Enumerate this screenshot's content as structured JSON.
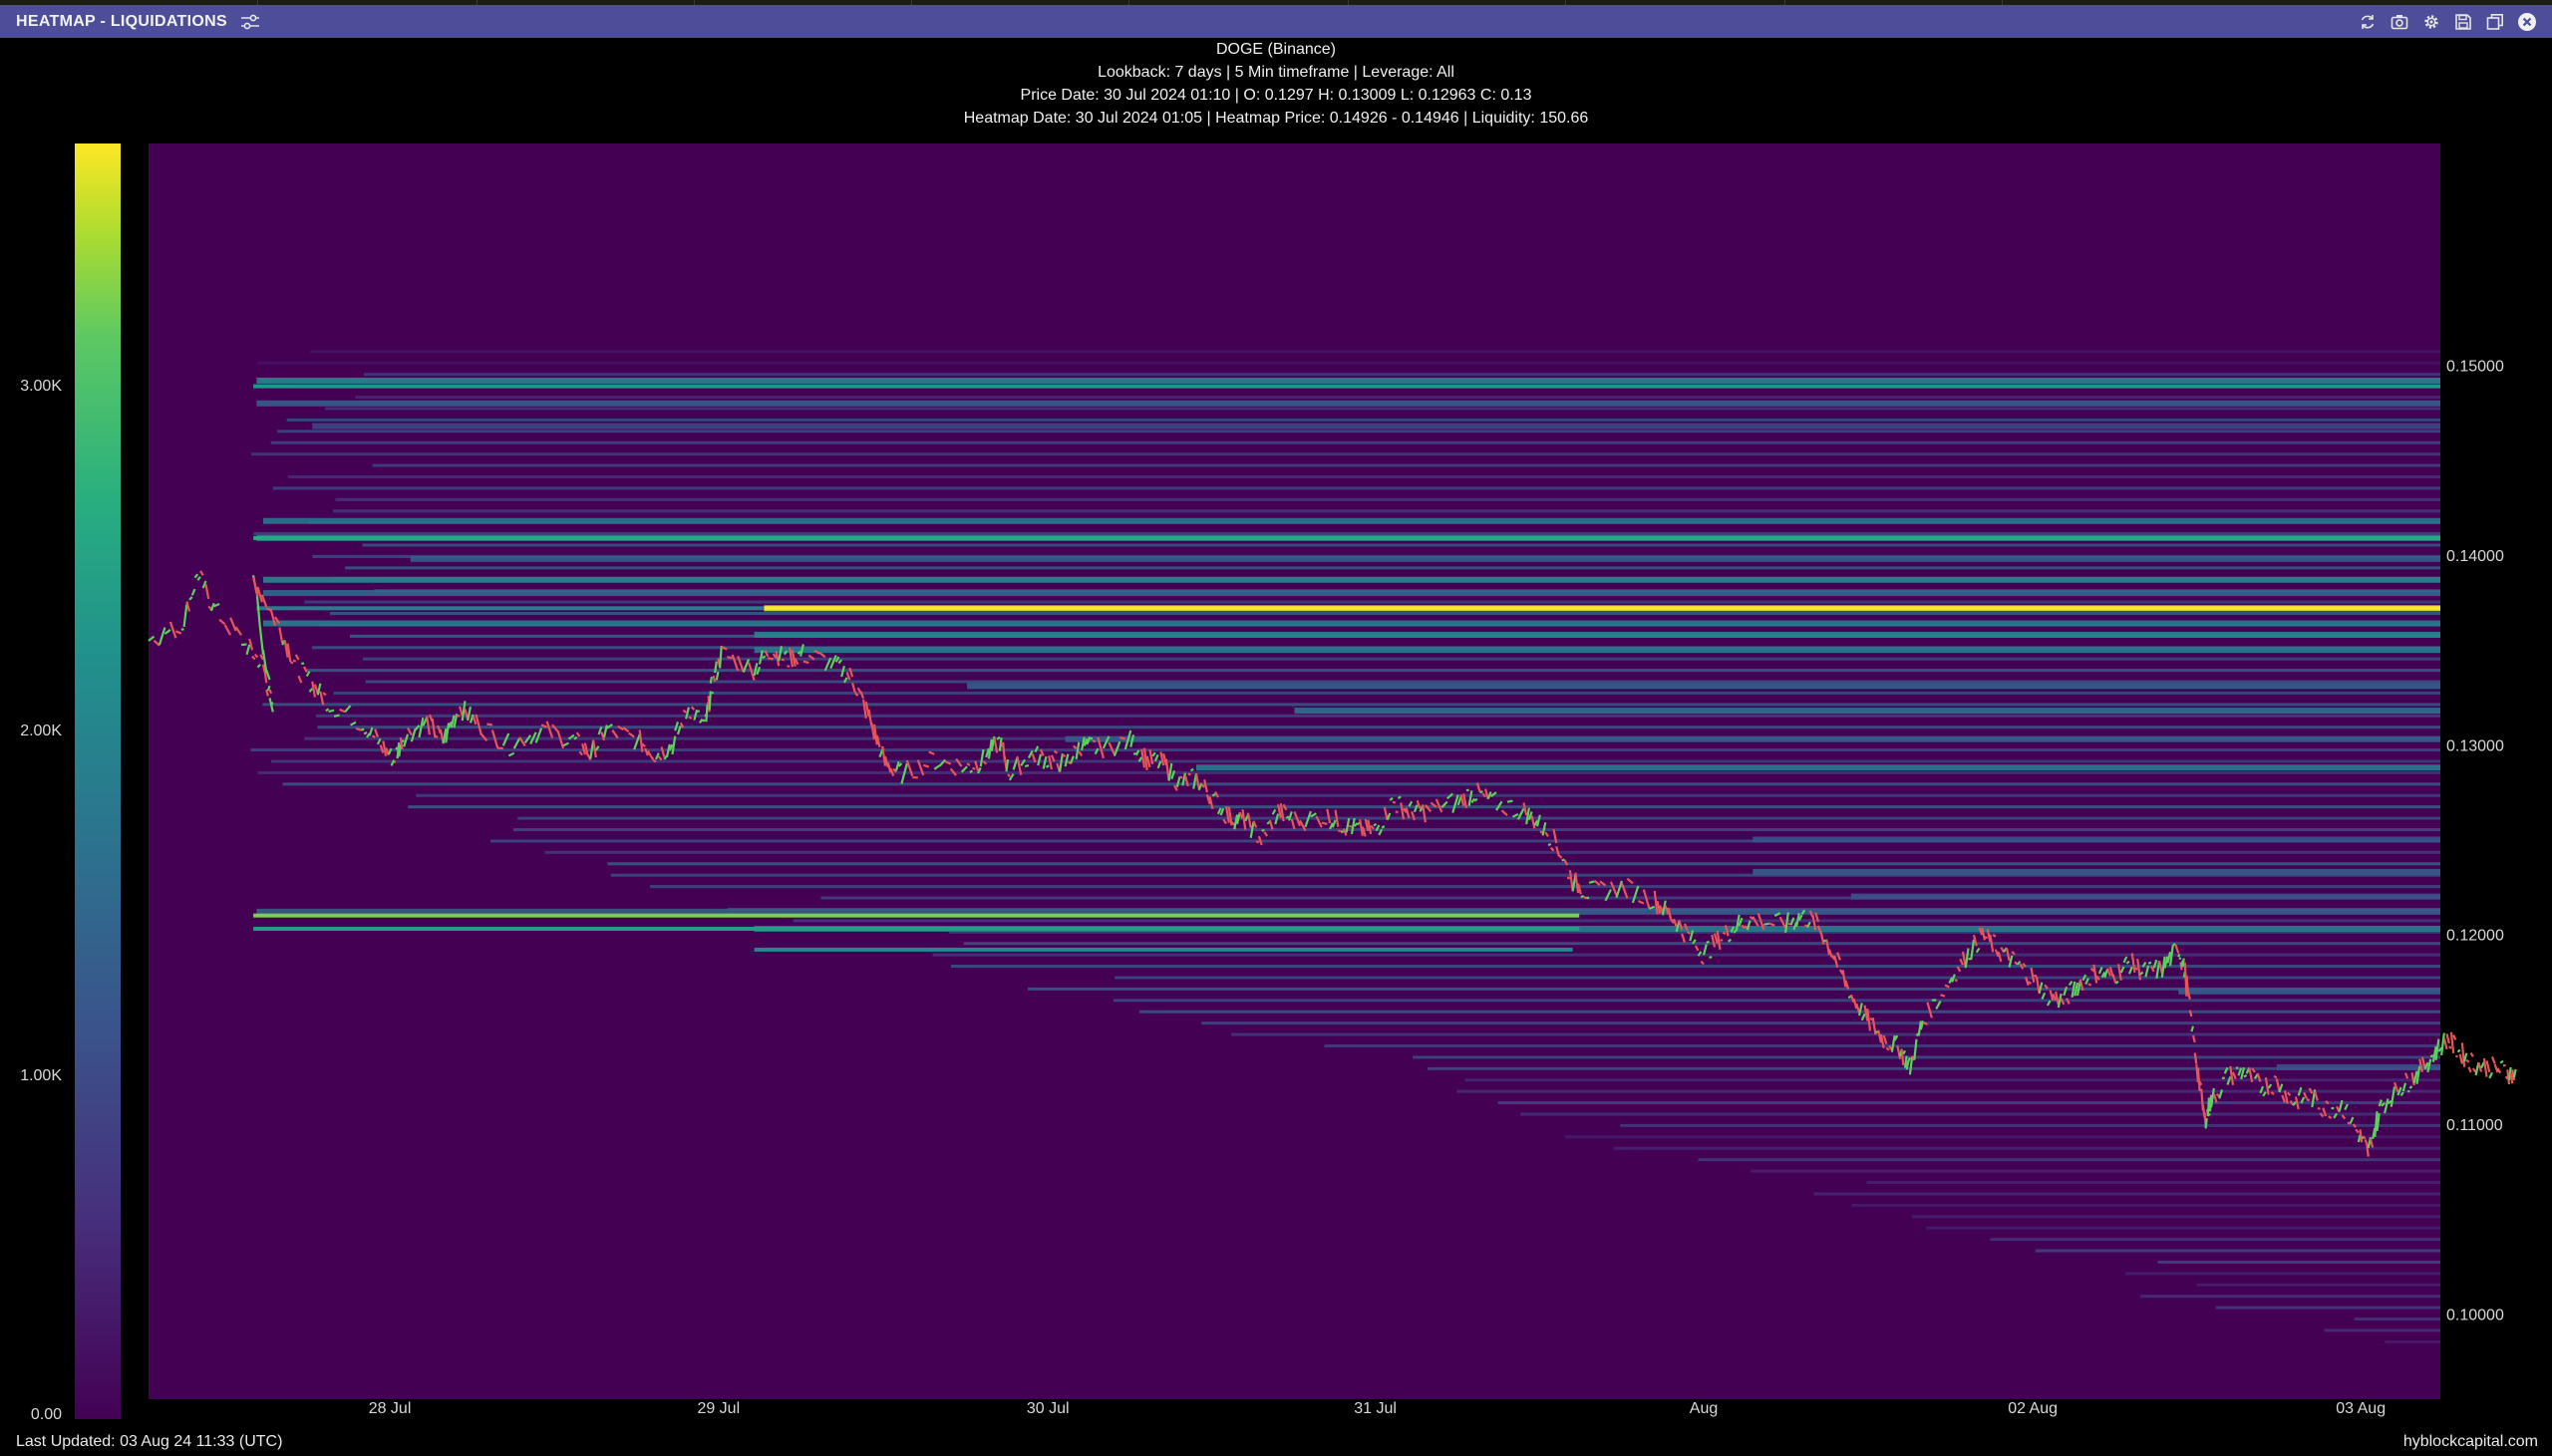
{
  "window": {
    "title": "HEATMAP - LIQUIDATIONS",
    "controls": [
      "refresh-icon",
      "camera-icon",
      "gear-icon",
      "save-icon",
      "copy-icon",
      "close-icon"
    ]
  },
  "header": {
    "line1": "DOGE (Binance)",
    "line2": "Lookback: 7 days | 5 Min timeframe | Leverage: All",
    "line3": "Price Date: 30 Jul 2024 01:10 | O: 0.1297 H: 0.13009 L: 0.12963 C: 0.13",
    "line4": "Heatmap Date: 30 Jul 2024 01:05 | Heatmap Price: 0.14926 - 0.14946 | Liquidity: 150.66"
  },
  "footer": {
    "last_updated": "Last Updated: 03 Aug 24 11:33 (UTC)",
    "brand": "hyblockcapital.com"
  },
  "colors": {
    "background": "#000000",
    "titlebar": "#4d4d9a",
    "heat_low": "#440154",
    "heat_high": "#fde725",
    "candle_up": "#5ad35a",
    "candle_down": "#e8545a"
  },
  "chart_data": {
    "type": "heatmap",
    "title": "DOGE (Binance)",
    "x_ticks": [
      {
        "label": "28 Jul",
        "t": 0.737
      },
      {
        "label": "29 Jul",
        "t": 1.741
      },
      {
        "label": "30 Jul",
        "t": 2.747
      },
      {
        "label": "31 Jul",
        "t": 3.747
      },
      {
        "label": "Aug",
        "t": 4.75
      },
      {
        "label": "02 Aug",
        "t": 5.755
      },
      {
        "label": "03 Aug",
        "t": 6.757
      }
    ],
    "x_range_days": [
      0,
      7
    ],
    "y_ticks": [
      0.15,
      0.14,
      0.13,
      0.12,
      0.11,
      0.1
    ],
    "y_tick_labels": [
      "0.15000",
      "0.14000",
      "0.13000",
      "0.12000",
      "0.11000",
      "0.10000"
    ],
    "ylim": [
      0.0955,
      0.1617
    ],
    "colorbar": {
      "range": [
        0,
        3700
      ],
      "ticks": [
        0,
        1000,
        2000,
        3000
      ],
      "tick_labels": [
        "0.00",
        "1.00K",
        "2.00K",
        "3.00K"
      ]
    },
    "liquidity_levels": [
      {
        "price": 0.1492,
        "intensity": 0.55,
        "t_start": 0.33
      },
      {
        "price": 0.148,
        "intensity": 0.35,
        "t_start": 0.33
      },
      {
        "price": 0.1468,
        "intensity": 0.25,
        "t_start": 0.5
      },
      {
        "price": 0.1418,
        "intensity": 0.45,
        "t_start": 0.35
      },
      {
        "price": 0.1409,
        "intensity": 0.55,
        "t_start": 0.33
      },
      {
        "price": 0.1398,
        "intensity": 0.35,
        "t_start": 0.8
      },
      {
        "price": 0.1387,
        "intensity": 0.55,
        "t_start": 0.35
      },
      {
        "price": 0.138,
        "intensity": 0.4,
        "t_start": 0.35
      },
      {
        "price": 0.1372,
        "intensity": 0.95,
        "t_start": 1.88
      },
      {
        "price": 0.1364,
        "intensity": 0.5,
        "t_start": 0.35
      },
      {
        "price": 0.1358,
        "intensity": 0.55,
        "t_start": 1.85
      },
      {
        "price": 0.135,
        "intensity": 0.5,
        "t_start": 1.85
      },
      {
        "price": 0.1331,
        "intensity": 0.35,
        "t_start": 2.5
      },
      {
        "price": 0.1318,
        "intensity": 0.45,
        "t_start": 3.5
      },
      {
        "price": 0.1303,
        "intensity": 0.35,
        "t_start": 2.8
      },
      {
        "price": 0.1288,
        "intensity": 0.5,
        "t_start": 3.2
      },
      {
        "price": 0.125,
        "intensity": 0.3,
        "t_start": 4.9
      },
      {
        "price": 0.1233,
        "intensity": 0.35,
        "t_start": 4.9
      },
      {
        "price": 0.122,
        "intensity": 0.3,
        "t_start": 5.2
      },
      {
        "price": 0.1212,
        "intensity": 0.35,
        "t_start": 0.33
      },
      {
        "price": 0.1203,
        "intensity": 0.5,
        "t_start": 1.85
      },
      {
        "price": 0.117,
        "intensity": 0.35,
        "t_start": 6.2
      },
      {
        "price": 0.113,
        "intensity": 0.3,
        "t_start": 6.5
      }
    ],
    "highlight_levels": [
      {
        "price": 0.1489,
        "intensity": 0.62,
        "t_start": 0.32,
        "t_end": 7.0
      },
      {
        "price": 0.1409,
        "intensity": 0.7,
        "t_start": 0.32,
        "t_end": 7.0
      },
      {
        "price": 0.1372,
        "intensity": 1.0,
        "t_start": 1.88,
        "t_end": 7.0
      },
      {
        "price": 0.1372,
        "intensity": 0.5,
        "t_start": 0.33,
        "t_end": 1.88
      },
      {
        "price": 0.121,
        "intensity": 0.88,
        "t_start": 0.32,
        "t_end": 4.37
      },
      {
        "price": 0.1203,
        "intensity": 0.65,
        "t_start": 0.32,
        "t_end": 4.37
      },
      {
        "price": 0.1192,
        "intensity": 0.55,
        "t_start": 1.85,
        "t_end": 4.35
      }
    ],
    "price_path": [
      [
        0.0,
        0.1356
      ],
      [
        0.1,
        0.1362
      ],
      [
        0.15,
        0.139
      ],
      [
        0.2,
        0.1372
      ],
      [
        0.3,
        0.1352
      ],
      [
        0.35,
        0.1342
      ],
      [
        0.38,
        0.1318
      ],
      [
        0.32,
        0.1388
      ],
      [
        0.4,
        0.1362
      ],
      [
        0.45,
        0.1342
      ],
      [
        0.5,
        0.1332
      ],
      [
        0.55,
        0.1322
      ],
      [
        0.65,
        0.1312
      ],
      [
        0.7,
        0.1302
      ],
      [
        0.75,
        0.1292
      ],
      [
        0.78,
        0.1305
      ],
      [
        0.85,
        0.1312
      ],
      [
        0.9,
        0.1302
      ],
      [
        0.95,
        0.132
      ],
      [
        1.0,
        0.1312
      ],
      [
        1.1,
        0.13
      ],
      [
        1.2,
        0.1308
      ],
      [
        1.3,
        0.1302
      ],
      [
        1.35,
        0.1295
      ],
      [
        1.4,
        0.1308
      ],
      [
        1.5,
        0.1302
      ],
      [
        1.55,
        0.1295
      ],
      [
        1.6,
        0.13
      ],
      [
        1.65,
        0.132
      ],
      [
        1.7,
        0.131
      ],
      [
        1.72,
        0.133
      ],
      [
        1.75,
        0.1348
      ],
      [
        1.85,
        0.134
      ],
      [
        1.9,
        0.135
      ],
      [
        1.95,
        0.1345
      ],
      [
        2.0,
        0.1348
      ],
      [
        2.1,
        0.1342
      ],
      [
        2.15,
        0.1335
      ],
      [
        2.2,
        0.1315
      ],
      [
        2.25,
        0.129
      ],
      [
        2.3,
        0.1285
      ],
      [
        2.4,
        0.1292
      ],
      [
        2.5,
        0.1288
      ],
      [
        2.55,
        0.1292
      ],
      [
        2.6,
        0.1302
      ],
      [
        2.63,
        0.1285
      ],
      [
        2.7,
        0.1295
      ],
      [
        2.75,
        0.1292
      ],
      [
        2.8,
        0.129
      ],
      [
        2.85,
        0.13
      ],
      [
        2.9,
        0.1298
      ],
      [
        3.0,
        0.1302
      ],
      [
        3.05,
        0.1292
      ],
      [
        3.1,
        0.129
      ],
      [
        3.15,
        0.128
      ],
      [
        3.2,
        0.1282
      ],
      [
        3.25,
        0.1272
      ],
      [
        3.3,
        0.1262
      ],
      [
        3.35,
        0.126
      ],
      [
        3.4,
        0.125
      ],
      [
        3.45,
        0.1265
      ],
      [
        3.5,
        0.126
      ],
      [
        3.6,
        0.1262
      ],
      [
        3.65,
        0.1258
      ],
      [
        3.7,
        0.1255
      ],
      [
        3.75,
        0.1255
      ],
      [
        3.8,
        0.127
      ],
      [
        3.85,
        0.1265
      ],
      [
        3.9,
        0.1265
      ],
      [
        4.0,
        0.127
      ],
      [
        4.05,
        0.1275
      ],
      [
        4.1,
        0.127
      ],
      [
        4.2,
        0.1265
      ],
      [
        4.25,
        0.1258
      ],
      [
        4.3,
        0.1248
      ],
      [
        4.35,
        0.1228
      ],
      [
        4.4,
        0.1222
      ],
      [
        4.5,
        0.1225
      ],
      [
        4.6,
        0.1218
      ],
      [
        4.65,
        0.121
      ],
      [
        4.7,
        0.12
      ],
      [
        4.75,
        0.119
      ],
      [
        4.8,
        0.1198
      ],
      [
        4.85,
        0.1205
      ],
      [
        4.9,
        0.1208
      ],
      [
        5.0,
        0.1205
      ],
      [
        5.05,
        0.121
      ],
      [
        5.1,
        0.1205
      ],
      [
        5.15,
        0.1188
      ],
      [
        5.2,
        0.1168
      ],
      [
        5.25,
        0.1155
      ],
      [
        5.3,
        0.1145
      ],
      [
        5.35,
        0.114
      ],
      [
        5.38,
        0.113
      ],
      [
        5.42,
        0.1155
      ],
      [
        5.5,
        0.1175
      ],
      [
        5.55,
        0.1188
      ],
      [
        5.6,
        0.12
      ],
      [
        5.65,
        0.1192
      ],
      [
        5.7,
        0.1185
      ],
      [
        5.75,
        0.1178
      ],
      [
        5.8,
        0.1168
      ],
      [
        5.85,
        0.1165
      ],
      [
        5.9,
        0.1175
      ],
      [
        5.95,
        0.118
      ],
      [
        6.0,
        0.1178
      ],
      [
        6.05,
        0.1185
      ],
      [
        6.1,
        0.118
      ],
      [
        6.15,
        0.1182
      ],
      [
        6.2,
        0.1193
      ],
      [
        6.22,
        0.118
      ],
      [
        6.25,
        0.114
      ],
      [
        6.28,
        0.1102
      ],
      [
        6.3,
        0.1112
      ],
      [
        6.35,
        0.1125
      ],
      [
        6.4,
        0.1128
      ],
      [
        6.45,
        0.112
      ],
      [
        6.5,
        0.1122
      ],
      [
        6.55,
        0.1112
      ],
      [
        6.6,
        0.1115
      ],
      [
        6.65,
        0.1108
      ],
      [
        6.7,
        0.111
      ],
      [
        6.75,
        0.1095
      ],
      [
        6.78,
        0.1085
      ],
      [
        6.82,
        0.111
      ],
      [
        6.88,
        0.112
      ],
      [
        6.92,
        0.1125
      ],
      [
        6.97,
        0.1135
      ],
      [
        7.02,
        0.1145
      ],
      [
        7.06,
        0.1138
      ],
      [
        7.1,
        0.1132
      ],
      [
        7.15,
        0.113
      ],
      [
        7.2,
        0.1128
      ],
      [
        7.23,
        0.1125
      ]
    ]
  }
}
